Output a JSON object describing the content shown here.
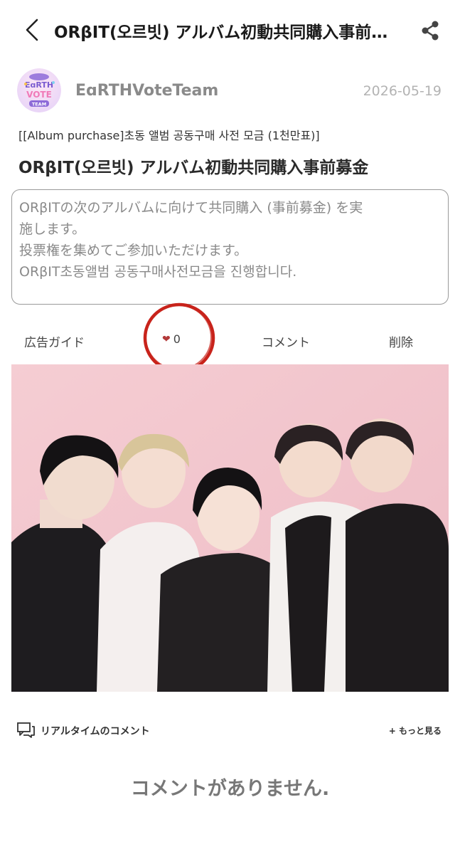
{
  "header": {
    "title": "ORβIT(오르빗) アルバム初動共同購入事前募金",
    "back_icon": "chevron-left-icon",
    "share_icon": "share-icon"
  },
  "author": {
    "name": "EɑRTHVoteTeam",
    "date": "2026-05-19",
    "avatar_text": "EɑRTH VOTE TEAM"
  },
  "post": {
    "tag": "[[Album purchase]초동 앨범 공동구매 사전 모금 (1천만표)]",
    "title": "ORβIT(오르빗) アルバム初動共同購入事前募金",
    "description_lines": [
      "ORβITの次のアルバムに向けて共同購入 (事前募金) を実",
      "施します。",
      "投票権を集めてご参加いただけます。",
      "ORβIT초동앨범 공동구매사전모금을 진행합니다."
    ]
  },
  "actions": {
    "ad_guide": "広告ガイド",
    "like_count": "0",
    "comment": "コメント",
    "delete": "削除"
  },
  "comments": {
    "header": "リアルタイムのコメント",
    "more": "+ もっと見る",
    "empty": "コメントがありません."
  },
  "colors": {
    "heart": "#b33a3a",
    "annotation_circle": "#c8231b",
    "photo_background": "#f2c8cf"
  }
}
